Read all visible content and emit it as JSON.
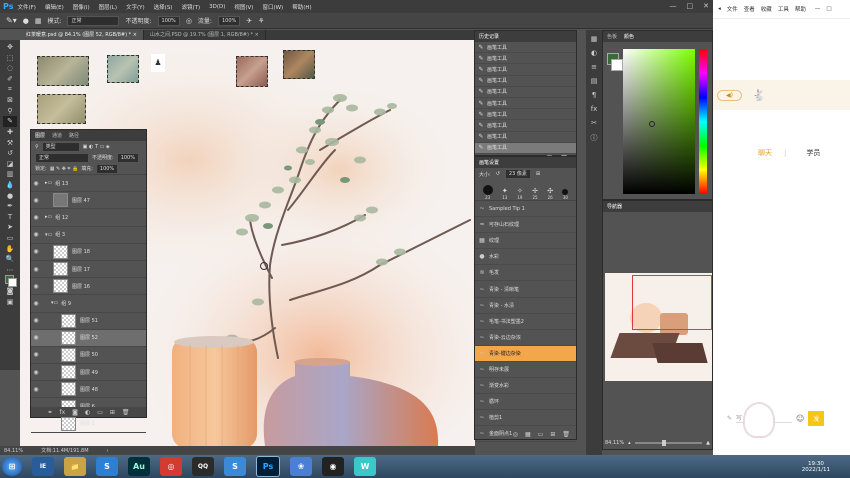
{
  "menubar": {
    "logo": "Ps",
    "items": [
      "文件(F)",
      "编辑(E)",
      "图像(I)",
      "图层(L)",
      "文字(Y)",
      "选择(S)",
      "滤镜(T)",
      "3D(D)",
      "视图(V)",
      "窗口(W)",
      "帮助(H)"
    ],
    "minimize": "—",
    "maximize": "□",
    "close": "✕"
  },
  "optbar": {
    "mode_label": "模式:",
    "mode_value": "正常",
    "opacity_label": "不透明度:",
    "opacity_value": "100%",
    "flow_label": "流量:",
    "flow_value": "100%"
  },
  "tabs": [
    {
      "label": "红茶暖意.psd @ 84.1% (图层 52, RGB/8#) *",
      "close": "×"
    },
    {
      "label": "山水之间.PSD @ 19.7% (图层 1, RGB/8#) *",
      "close": "×"
    }
  ],
  "layers": {
    "tabs": [
      "图层",
      "通道",
      "路径"
    ],
    "kind_label": "类型",
    "blend_mode": "正常",
    "opacity_label": "不透明度:",
    "opacity_value": "100%",
    "lock_label": "锁定:",
    "fill_label": "填充:",
    "fill_value": "100%",
    "rows": [
      {
        "name": "组 13",
        "type": "group"
      },
      {
        "name": "图层 47",
        "type": "layer"
      },
      {
        "name": "组 12",
        "type": "group"
      },
      {
        "name": "组 3",
        "type": "group"
      },
      {
        "name": "图层 18",
        "type": "layer"
      },
      {
        "name": "图层 17",
        "type": "layer"
      },
      {
        "name": "图层 16",
        "type": "layer"
      },
      {
        "name": "组 9",
        "type": "group"
      },
      {
        "name": "图层 51",
        "type": "layer"
      },
      {
        "name": "图层 52",
        "type": "layer"
      },
      {
        "name": "图层 50",
        "type": "layer"
      },
      {
        "name": "图层 49",
        "type": "layer"
      },
      {
        "name": "图层 48",
        "type": "layer"
      },
      {
        "name": "图层 6",
        "type": "layer"
      },
      {
        "name": "图层 5",
        "type": "layer"
      }
    ]
  },
  "history": {
    "tabs": [
      "历史记录"
    ],
    "items": [
      "画笔工具",
      "画笔工具",
      "画笔工具",
      "画笔工具",
      "画笔工具",
      "画笔工具",
      "画笔工具",
      "画笔工具",
      "画笔工具",
      "画笔工具"
    ]
  },
  "brushes": {
    "tabs": [
      "画笔设置"
    ],
    "size_label": "大小:",
    "size_value": "23 像素",
    "tip_sizes": [
      "23",
      "13",
      "19",
      "25",
      "26",
      "30"
    ],
    "items": [
      "Sampled Tip 1",
      "可存山石纹理",
      "纹理",
      "水彩",
      "毛发",
      "青染 - 清晰笔",
      "青染 - 水渍",
      "毛笔-书法塑墨2",
      "青染-云边杂浓",
      "青染-键边杂染",
      "明存未展",
      "渐变水彩",
      "循环",
      "植剪1",
      "金面阴点1"
    ],
    "selected_index": 9,
    "item_sizes": [
      "",
      "",
      "",
      "90",
      "",
      "",
      "",
      "",
      "",
      "",
      "",
      "",
      "",
      "",
      ""
    ]
  },
  "colorpanel": {
    "tabs": [
      "色板",
      "颜色"
    ]
  },
  "navigator": {
    "tabs": [
      "导航器"
    ],
    "zoom": "84.11%"
  },
  "status": {
    "zoom": "84.11%",
    "doc": "文档:11.4M/191.8M"
  },
  "chat": {
    "window_items": [
      "文件",
      "查看",
      "收藏",
      "工具",
      "帮助"
    ],
    "tab_chat": "聊天",
    "tab_students": "学员",
    "input_placeholder": "写",
    "send": "发"
  },
  "taskbar": {
    "apps": [
      "⊞",
      "IE",
      "📁",
      "S",
      "Au",
      "◎",
      "QQ",
      "S",
      "Ps",
      "❀",
      "◉",
      "W"
    ],
    "time": "19:30",
    "date": "2022/1/11"
  },
  "colors": {
    "accent_orange": "#f3a74b",
    "ps_blue": "#31a8ff",
    "chat_accent": "#f5c518"
  }
}
